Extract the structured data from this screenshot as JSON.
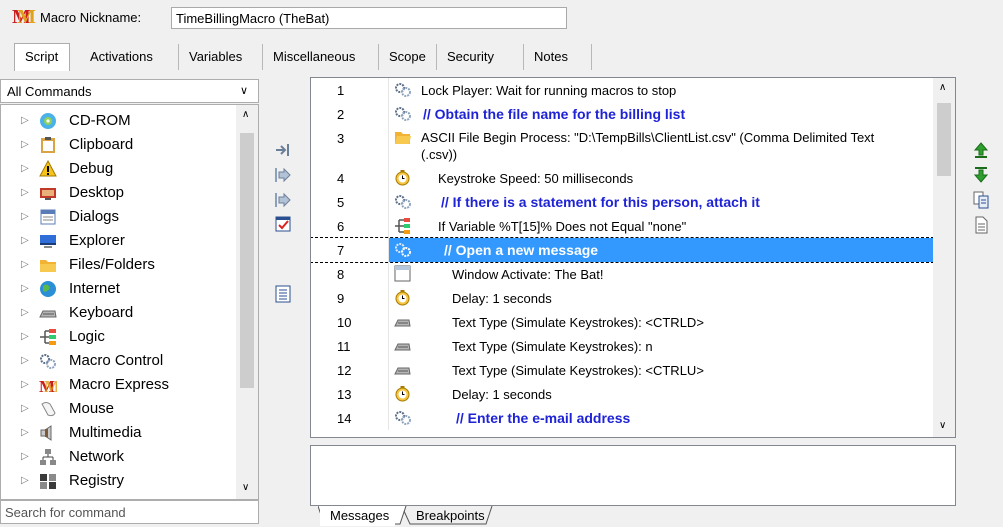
{
  "header": {
    "nickname_label": "Macro Nickname:",
    "nickname_value": "TimeBillingMacro (TheBat)",
    "logo_letter": "M"
  },
  "tabs": [
    {
      "label": "Script",
      "active": true
    },
    {
      "label": "Activations"
    },
    {
      "label": "Variables"
    },
    {
      "label": "Miscellaneous"
    },
    {
      "label": "Scope"
    },
    {
      "label": "Security"
    },
    {
      "label": "Notes"
    }
  ],
  "commands": {
    "filter": "All Commands",
    "search_placeholder": "Search for command",
    "items": [
      {
        "label": "CD-ROM",
        "icon": "cd-rom-icon"
      },
      {
        "label": "Clipboard",
        "icon": "clipboard-icon"
      },
      {
        "label": "Debug",
        "icon": "warning-icon"
      },
      {
        "label": "Desktop",
        "icon": "desktop-icon"
      },
      {
        "label": "Dialogs",
        "icon": "dialog-icon"
      },
      {
        "label": "Explorer",
        "icon": "explorer-icon"
      },
      {
        "label": "Files/Folders",
        "icon": "folder-icon"
      },
      {
        "label": "Internet",
        "icon": "globe-icon"
      },
      {
        "label": "Keyboard",
        "icon": "keyboard-icon"
      },
      {
        "label": "Logic",
        "icon": "logic-icon"
      },
      {
        "label": "Macro Control",
        "icon": "gears-icon"
      },
      {
        "label": "Macro Express",
        "icon": "macro-express-icon"
      },
      {
        "label": "Mouse",
        "icon": "mouse-icon"
      },
      {
        "label": "Multimedia",
        "icon": "speaker-icon"
      },
      {
        "label": "Network",
        "icon": "network-icon"
      },
      {
        "label": "Registry",
        "icon": "registry-icon"
      }
    ]
  },
  "script": {
    "rows": [
      {
        "num": "1",
        "text": "Lock Player: Wait for running macros to stop",
        "icon": "gears-icon",
        "indent": 0,
        "comment": false
      },
      {
        "num": "2",
        "text": "// Obtain the file name for the billing list",
        "icon": "gears-icon",
        "indent": 0,
        "comment": true
      },
      {
        "num": "3",
        "text": "ASCII File Begin Process: \"D:\\TempBills\\ClientList.csv\" (Comma Delimited Text",
        "text2": "(.csv))",
        "icon": "folder-icon",
        "indent": 0,
        "comment": false
      },
      {
        "num": "4",
        "text": "Keystroke Speed: 50 milliseconds",
        "icon": "clock-icon",
        "indent": 1,
        "comment": false
      },
      {
        "num": "5",
        "text": "// If there is a statement for this person, attach it",
        "icon": "gears-icon",
        "indent": 1,
        "comment": true
      },
      {
        "num": "6",
        "text": "If Variable %T[15]% Does not Equal \"none\"",
        "icon": "logic-icon",
        "indent": 1,
        "comment": false
      },
      {
        "num": "7",
        "text": "// Open a new message",
        "icon": "gears-icon",
        "indent": 2,
        "comment": true,
        "selected": true
      },
      {
        "num": "8",
        "text": "Window Activate: The Bat!",
        "icon": "window-icon",
        "indent": 2,
        "comment": false
      },
      {
        "num": "9",
        "text": "Delay: 1 seconds",
        "icon": "clock-icon",
        "indent": 2,
        "comment": false
      },
      {
        "num": "10",
        "text": "Text Type (Simulate Keystrokes): <CTRLD>",
        "icon": "keyboard-icon",
        "indent": 2,
        "comment": false
      },
      {
        "num": "11",
        "text": "Text Type (Simulate Keystrokes): n",
        "icon": "keyboard-icon",
        "indent": 2,
        "comment": false
      },
      {
        "num": "12",
        "text": "Text Type (Simulate Keystrokes): <CTRLU>",
        "icon": "keyboard-icon",
        "indent": 2,
        "comment": false
      },
      {
        "num": "13",
        "text": "Delay: 1 seconds",
        "icon": "clock-icon",
        "indent": 2,
        "comment": false
      },
      {
        "num": "14",
        "text": "// Enter the e-mail address",
        "icon": "gears-icon",
        "indent": 2,
        "comment": true
      }
    ]
  },
  "bottom_tabs": [
    {
      "label": "Messages",
      "active": true
    },
    {
      "label": "Breakpoints"
    }
  ],
  "colors": {
    "selection": "#3399ff",
    "comment": "#1f23d6",
    "panel_bg": "#f0f0f0"
  }
}
